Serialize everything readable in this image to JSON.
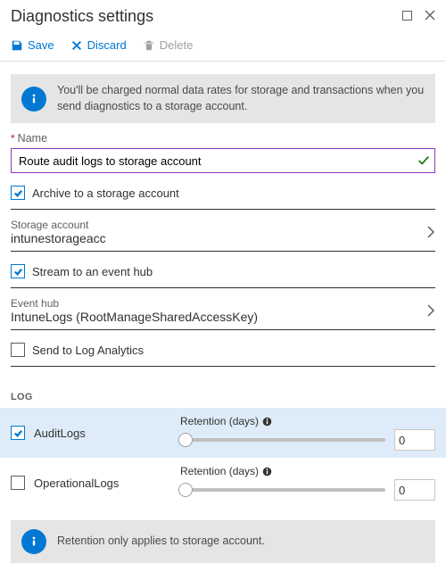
{
  "header": {
    "title": "Diagnostics settings"
  },
  "toolbar": {
    "save": "Save",
    "discard": "Discard",
    "delete": "Delete"
  },
  "info_banner": "You'll be charged normal data rates for storage and transactions when you send diagnostics to a storage account.",
  "name_field": {
    "label": "Name",
    "value": "Route audit logs to storage account"
  },
  "archive": {
    "label": "Archive to a storage account"
  },
  "storage_account": {
    "label": "Storage account",
    "value": "intunestorageacc"
  },
  "stream": {
    "label": "Stream to an event hub"
  },
  "event_hub": {
    "label": "Event hub",
    "value": "IntuneLogs (RootManageSharedAccessKey)"
  },
  "send_la": {
    "label": "Send to Log Analytics"
  },
  "log_caption": "LOG",
  "retention_label": "Retention (days)",
  "logs": {
    "audit": {
      "name": "AuditLogs",
      "value": "0"
    },
    "ops": {
      "name": "OperationalLogs",
      "value": "0"
    }
  },
  "retention_banner": "Retention only applies to storage account."
}
